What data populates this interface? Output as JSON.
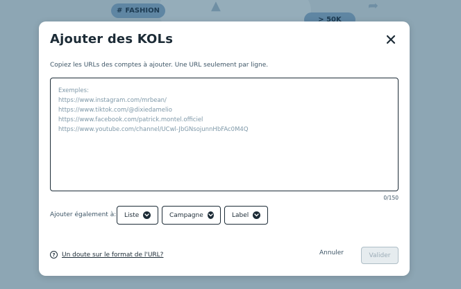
{
  "background": {
    "chip_fashion": "FASHION",
    "chip_followers": "> 50K"
  },
  "modal": {
    "title": "Ajouter des KOLs",
    "instructions": "Copiez les URLs des comptes à ajouter. Une URL seulement par ligne.",
    "textarea": {
      "value": "",
      "placeholder_lines": [
        "Exemples:",
        "https://www.instagram.com/mrbean/",
        "https://www.tiktok.com/@dixiedamelio",
        "https://www.facebook.com/patrick.montel.officiel",
        "https://www.youtube.com/channel/UCwl-JbGNsojunnHbFAc0M4Q"
      ]
    },
    "counter": "0/150",
    "also_add_label": "Ajouter également à:",
    "dropdowns": {
      "liste": "Liste",
      "campagne": "Campagne",
      "label": "Label"
    },
    "help_link": "Un doute sur le format de l'URL?",
    "cancel_label": "Annuler",
    "validate_label": "Valider"
  },
  "colors": {
    "primary_dark": "#1c2b36",
    "overlay": "#8da6b4",
    "disabled_bg": "#e6ecef"
  },
  "icons": [
    "hashtag-icon",
    "thumbs-up-icon",
    "share-icon",
    "close-icon",
    "chevron-down-icon",
    "help-circle-icon"
  ]
}
